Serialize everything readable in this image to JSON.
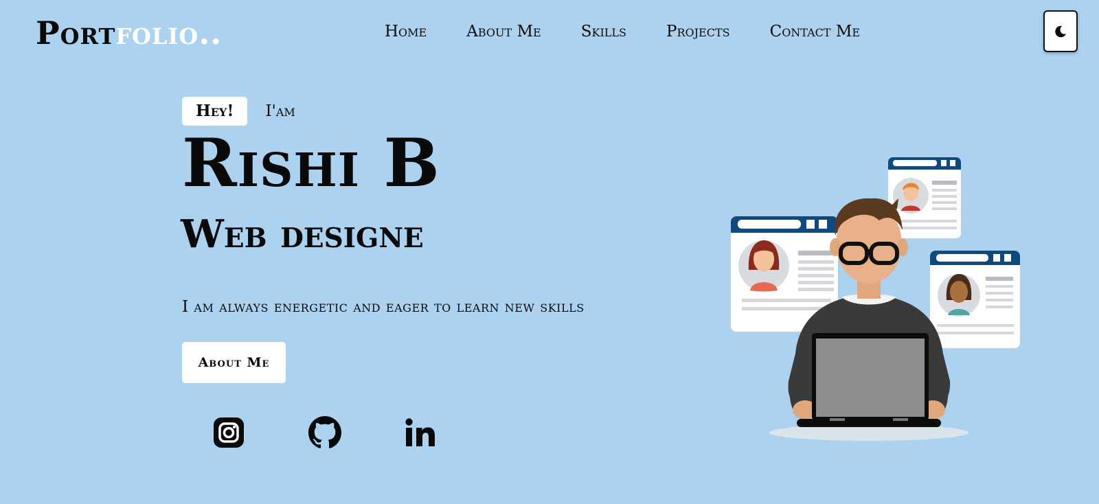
{
  "header": {
    "logo_part1": "Port",
    "logo_part2": "folio..",
    "nav": [
      "Home",
      "About Me",
      "Skills",
      "Projects",
      "Contact Me"
    ],
    "theme_toggle_icon": "moon-icon"
  },
  "hero": {
    "greeting": "Hey!",
    "intro": "I'am",
    "name": "Rishi B",
    "role": "Web designe",
    "tagline": "I am always energetic and eager to learn new skills",
    "cta_label": "About Me"
  },
  "social_icons": [
    "instagram-icon",
    "github-icon",
    "linkedin-icon"
  ],
  "colors": {
    "background": "#acd2f0",
    "accent": "#ffffff",
    "text": "#0a0a0a",
    "illustration_window": "#0e4a7e"
  }
}
